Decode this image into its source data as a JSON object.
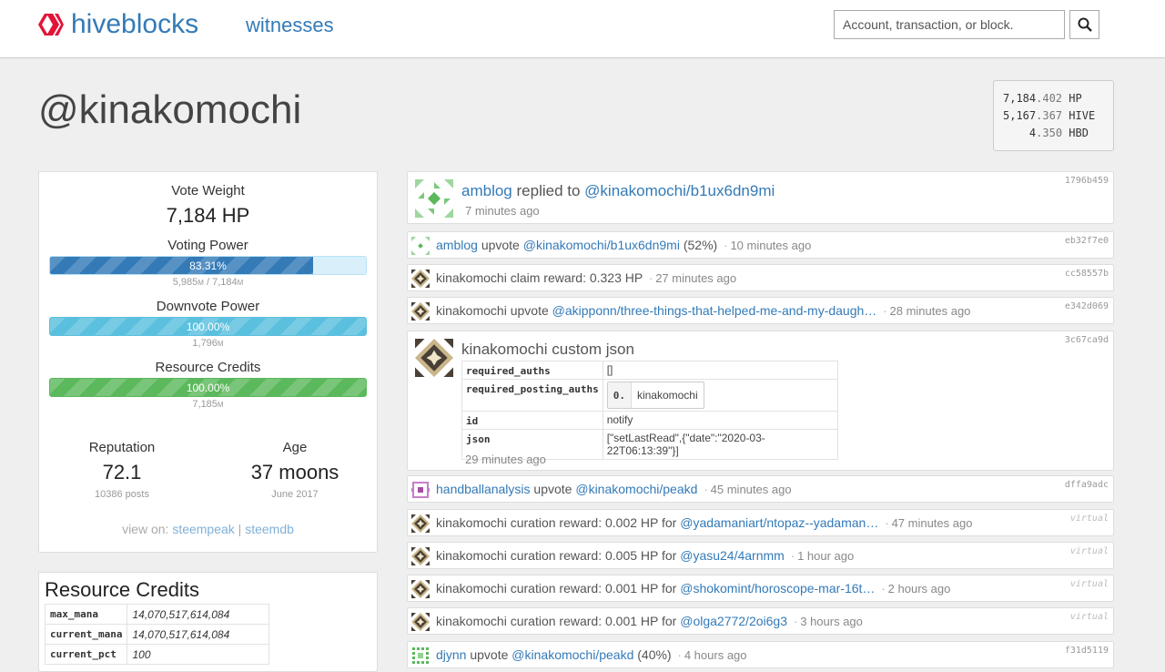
{
  "nav": {
    "brand": "hiveblocks",
    "witnesses": "witnesses",
    "search_placeholder": "Account, transaction, or block."
  },
  "account": {
    "name": "@kinakomochi",
    "balances": [
      {
        "int": "7,184",
        "dec": ".402",
        "unit": "HP",
        "pad": ""
      },
      {
        "int": "5,167",
        "dec": ".367",
        "unit": "HIVE",
        "pad": ""
      },
      {
        "int": "4",
        "dec": ".350",
        "unit": "HBD",
        "pad": "    "
      }
    ]
  },
  "power": {
    "vote_weight_label": "Vote Weight",
    "vote_weight_value": "7,184 HP",
    "voting_power_label": "Voting Power",
    "voting_power_pct": "83.31%",
    "voting_power_fraction": 0.8331,
    "voting_power_sub_a": "5,985",
    "voting_power_sub_b": "7,184",
    "voting_power_unit": "M",
    "downvote_label": "Downvote Power",
    "downvote_pct": "100.00%",
    "downvote_fraction": 1.0,
    "downvote_sub": "1,796",
    "rc_label": "Resource Credits",
    "rc_pct": "100.00%",
    "rc_fraction": 1.0,
    "rc_sub": "7,185",
    "reputation_label": "Reputation",
    "reputation_value": "72.1",
    "reputation_sub": "10386 posts",
    "age_label": "Age",
    "age_value": "37 moons",
    "age_sub": "June 2017",
    "view_on_label": "view on:",
    "view_on_links": [
      "steempeak",
      "steemdb"
    ],
    "colors": {
      "voting": "#337ab7",
      "voting_bg": "#d9f0fb",
      "downvote": "#5bc0de",
      "rc": "#5cb85c"
    }
  },
  "rc": {
    "title": "Resource Credits",
    "rows": [
      {
        "k": "max_mana",
        "v": "14,070,517,614,084"
      },
      {
        "k": "current_mana",
        "v": "14,070,517,614,084"
      },
      {
        "k": "current_pct",
        "v": "100"
      }
    ]
  },
  "feed": {
    "op0": {
      "hash": "1796b459",
      "author": "amblog",
      "action": "replied to",
      "target": "@kinakomochi/b1ux6dn9mi",
      "ago": "7 minutes ago"
    },
    "op1": {
      "hash": "eb32f7e0",
      "author": "amblog",
      "action": "upvote",
      "target": "@kinakomochi/b1ux6dn9mi",
      "extra": "(52%)",
      "ago": "10 minutes ago"
    },
    "op2": {
      "hash": "cc58557b",
      "author": "kinakomochi",
      "text": "claim reward: 0.323 HP",
      "ago": "27 minutes ago"
    },
    "op3": {
      "hash": "e342d069",
      "author": "kinakomochi",
      "action": "upvote",
      "target": "@akipponn/three-things-that-helped-me-and-my-daugh…",
      "ago": "28 minutes ago"
    },
    "op4": {
      "hash": "3c67ca9d",
      "author": "kinakomochi",
      "action": "custom json",
      "ago": "29 minutes ago",
      "required_auths_k": "required_auths",
      "required_auths_v": "[]",
      "required_posting_auths_k": "required_posting_auths",
      "rpa_idx": "0.",
      "rpa_val": "kinakomochi",
      "id_k": "id",
      "id_v": "notify",
      "json_k": "json",
      "json_v": "[\"setLastRead\",{\"date\":\"2020-03-22T06:13:39\"}]"
    },
    "op5": {
      "hash": "dffa9adc",
      "author": "handballanalysis",
      "action": "upvote",
      "target": "@kinakomochi/peakd",
      "ago": "45 minutes ago"
    },
    "op6": {
      "hash": "virtual",
      "author": "kinakomochi",
      "text": "curation reward: 0.002 HP for",
      "target": "@yadamaniart/ntopaz--yadaman…",
      "ago": "47 minutes ago"
    },
    "op7": {
      "hash": "virtual",
      "author": "kinakomochi",
      "text": "curation reward: 0.005 HP for",
      "target": "@yasu24/4arnmm",
      "ago": "1 hour ago"
    },
    "op8": {
      "hash": "virtual",
      "author": "kinakomochi",
      "text": "curation reward: 0.001 HP for",
      "target": "@shokomint/horoscope-mar-16t…",
      "ago": "2 hours ago"
    },
    "op9": {
      "hash": "virtual",
      "author": "kinakomochi",
      "text": "curation reward: 0.001 HP for",
      "target": "@olga2772/2oi6g3",
      "ago": "3 hours ago"
    },
    "op10": {
      "hash": "f31d5119",
      "author": "djynn",
      "action": "upvote",
      "target": "@kinakomochi/peakd",
      "extra": "(40%)",
      "ago": "4 hours ago"
    }
  }
}
